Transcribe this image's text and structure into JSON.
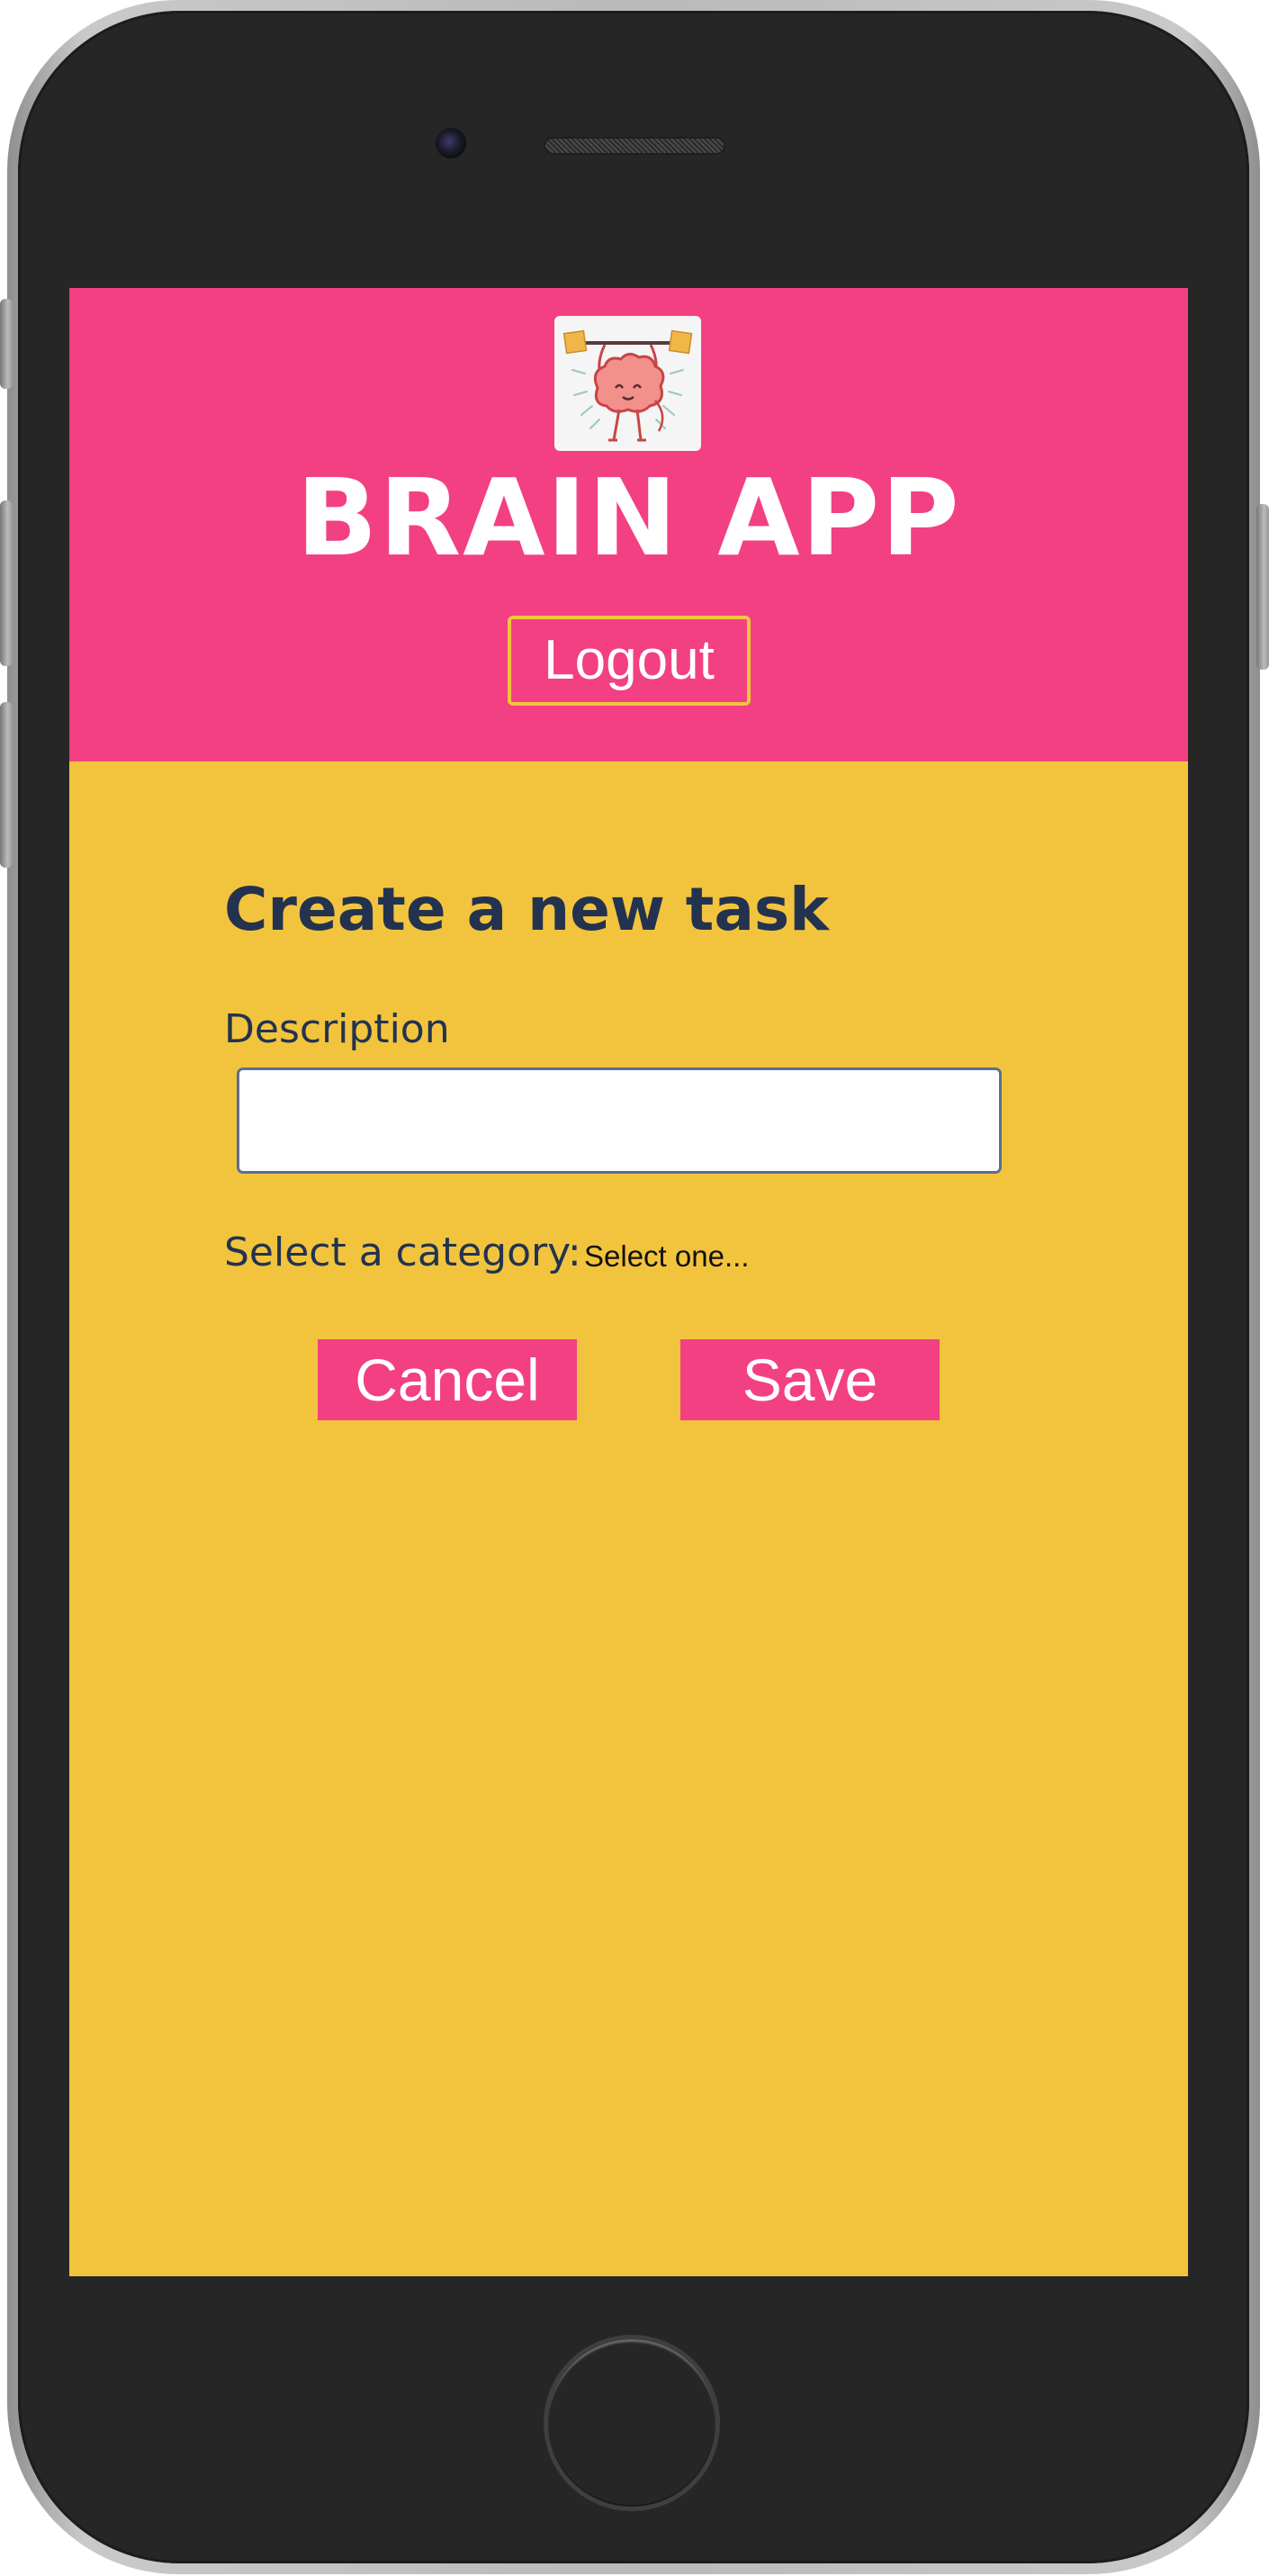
{
  "app": {
    "title": "BRAIN APP",
    "logo": "brain-lifting-weights-logo",
    "logout_label": "Logout"
  },
  "form": {
    "title": "Create a new task",
    "description_label": "Description",
    "description_value": "",
    "description_placeholder": "",
    "category_label": "Select a category:",
    "category_selected": "Select one...",
    "cancel_label": "Cancel",
    "save_label": "Save"
  },
  "colors": {
    "header": "#f24083",
    "background": "#f2c43e",
    "text": "#23334f",
    "button": "#f24083"
  }
}
